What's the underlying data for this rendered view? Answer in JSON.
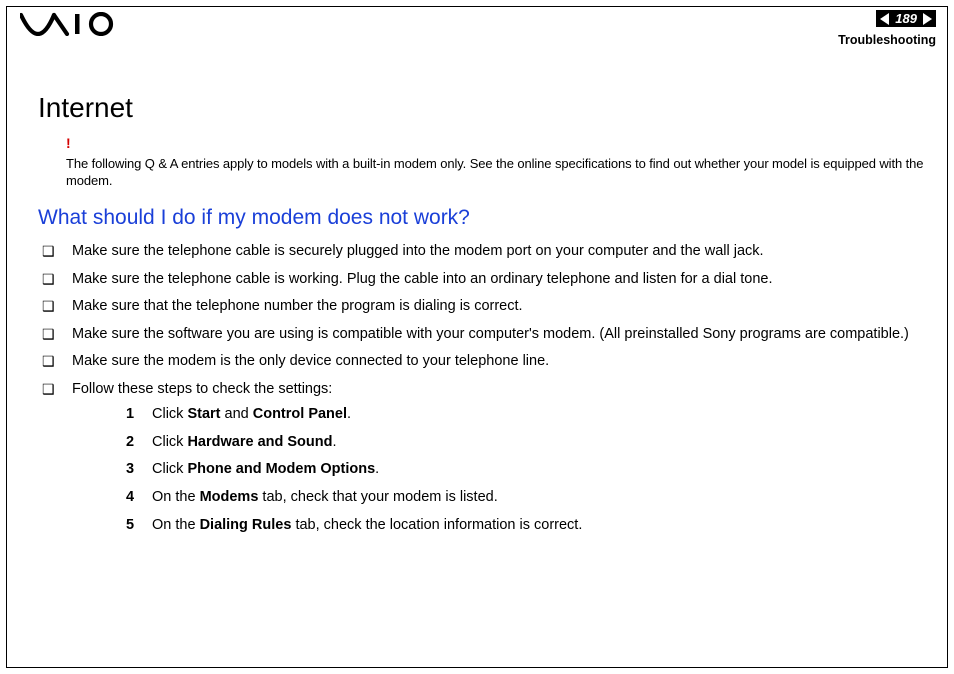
{
  "header": {
    "page_number": "189",
    "section": "Troubleshooting"
  },
  "title": "Internet",
  "note": "The following Q & A entries apply to models with a built-in modem only. See the online specifications to find out whether your model is equipped with the modem.",
  "question": "What should I do if my modem does not work?",
  "bullets": [
    "Make sure the telephone cable is securely plugged into the modem port on your computer and the wall jack.",
    "Make sure the telephone cable is working. Plug the cable into an ordinary telephone and listen for a dial tone.",
    "Make sure that the telephone number the program is dialing is correct.",
    "Make sure the software you are using is compatible with your computer's modem. (All preinstalled Sony programs are compatible.)",
    "Make sure the modem is the only device connected to your telephone line.",
    "Follow these steps to check the settings:"
  ],
  "steps": [
    {
      "pre": "Click ",
      "bold1": "Start",
      "mid": " and ",
      "bold2": "Control Panel",
      "post": "."
    },
    {
      "pre": "Click ",
      "bold1": "Hardware and Sound",
      "mid": "",
      "bold2": "",
      "post": "."
    },
    {
      "pre": "Click ",
      "bold1": "Phone and Modem Options",
      "mid": "",
      "bold2": "",
      "post": "."
    },
    {
      "pre": "On the ",
      "bold1": "Modems",
      "mid": " tab, check that your modem is listed.",
      "bold2": "",
      "post": ""
    },
    {
      "pre": "On the ",
      "bold1": "Dialing Rules",
      "mid": " tab, check the location information is correct.",
      "bold2": "",
      "post": ""
    }
  ]
}
